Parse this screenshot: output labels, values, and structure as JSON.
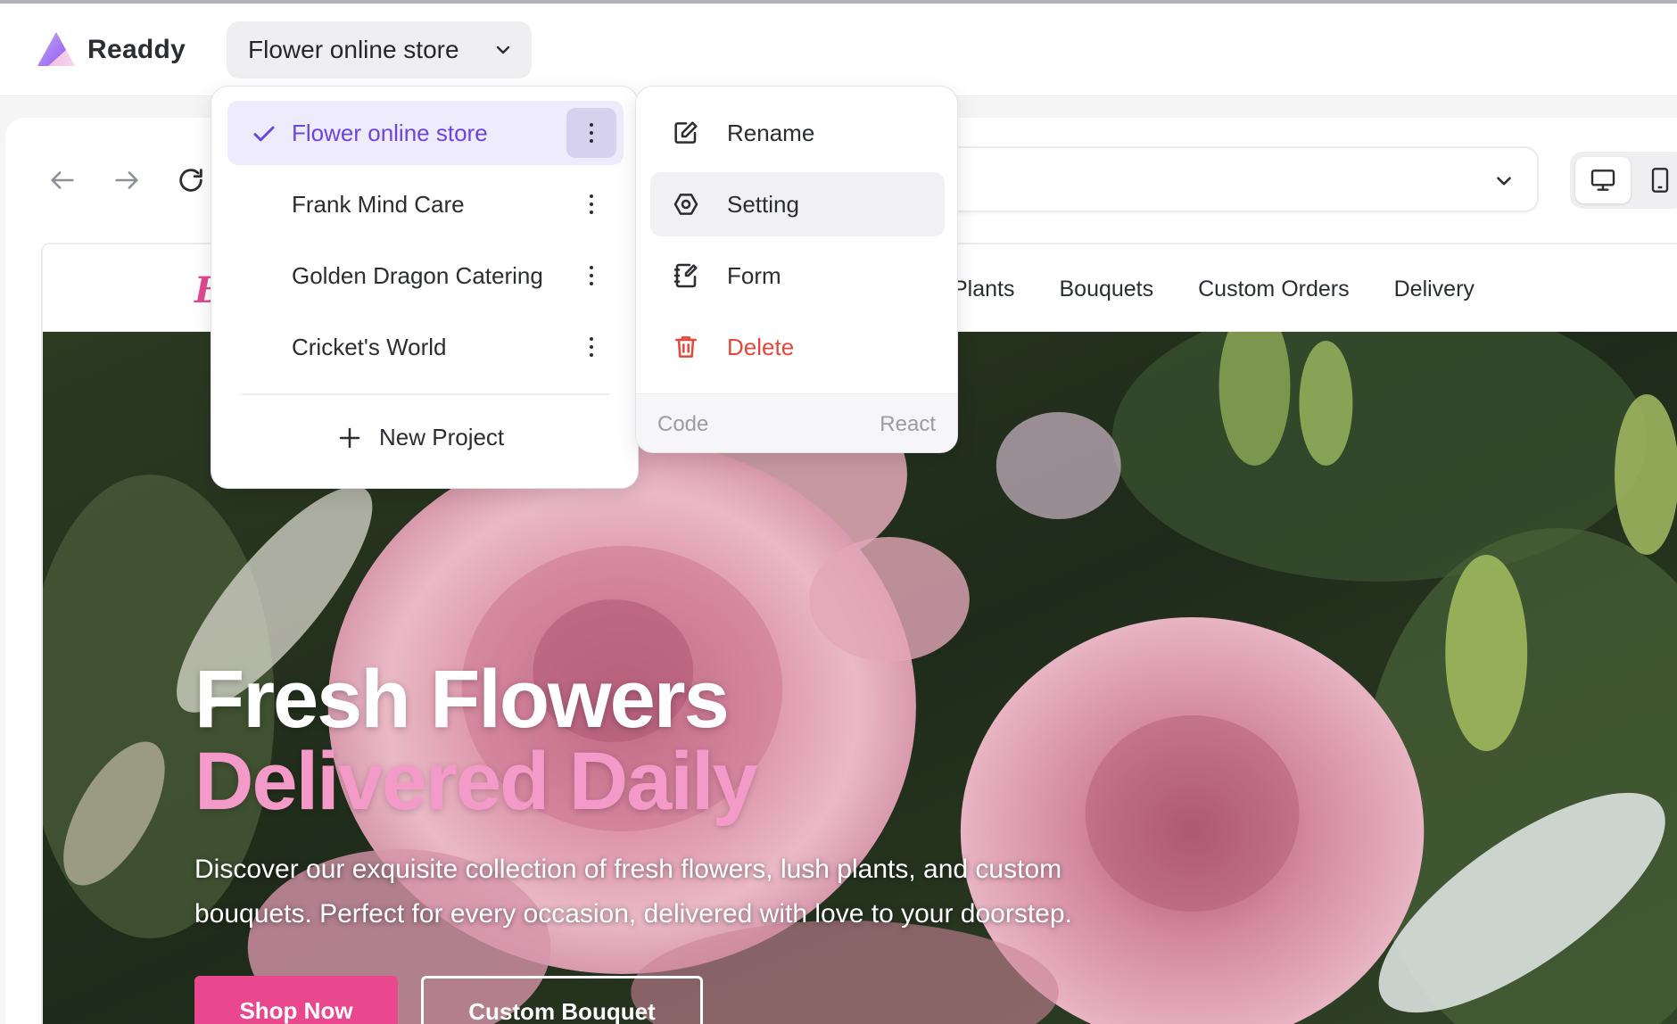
{
  "app": {
    "name": "Readdy"
  },
  "project_selector": {
    "current": "Flower online store"
  },
  "projects": [
    {
      "name": "Flower online store",
      "active": true
    },
    {
      "name": "Frank Mind Care",
      "active": false
    },
    {
      "name": "Golden Dragon Catering",
      "active": false
    },
    {
      "name": "Cricket's World",
      "active": false
    }
  ],
  "new_project_label": "New Project",
  "context_menu": {
    "items": [
      {
        "label": "Rename",
        "icon": "edit-icon"
      },
      {
        "label": "Setting",
        "icon": "settings-icon"
      },
      {
        "label": "Form",
        "icon": "form-icon"
      },
      {
        "label": "Delete",
        "icon": "trash-icon"
      }
    ],
    "footer": {
      "left": "Code",
      "right": "React"
    }
  },
  "site": {
    "logo_text": "B",
    "nav_links": [
      "Plants",
      "Bouquets",
      "Custom Orders",
      "Delivery"
    ],
    "hero": {
      "title_line1": "Fresh Flowers",
      "title_line2": "Delivered Daily",
      "description": "Discover our exquisite collection of fresh flowers, lush plants, and custom bouquets. Perfect for every occasion, delivered with love to your doorstep.",
      "primary_cta": "Shop Now",
      "secondary_cta": "Custom Bouquet"
    }
  },
  "colors": {
    "accent": "#6a45e0",
    "active_item_bg": "#eeebfc",
    "danger": "#e5483b",
    "site_pink": "#e9488f",
    "hero_pink_text": "#f49ac8"
  }
}
